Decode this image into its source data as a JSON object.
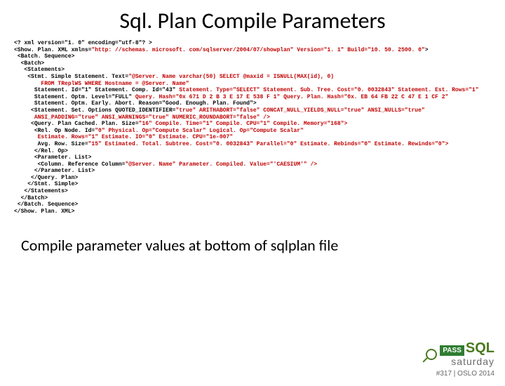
{
  "title": "Sql. Plan Compile Parameters",
  "xml": {
    "decl": "<? xml version=\"1. 0\" encoding=\"utf-8\"? >",
    "showplan_open": "<Show. Plan. XML xmlns=",
    "showplan_ns": "\"http: //schemas. microsoft. com/sqlserver/2004/07/showplan\"",
    "showplan_ver": " Version=\"1. 1\" Build=\"10. 50. 2500. 0\"",
    "showplan_close": ">",
    "batchseq_open": " <Batch. Sequence>",
    "batch_open": "  <Batch>",
    "statements_open": "   <Statements>",
    "stmtsimple_open": "    <Stmt. Simple Statement. Text=",
    "stmt_text": "\"@Server. Name varchar(50) SELECT @maxid = ISNULL(MAX(id), 0)",
    "stmt_text2": "        FROM TReplWS WHERE Hostname = @Server. Name\"",
    "stmt_line_a": "      Statement. Id=\"1\" Statement. Comp. Id=\"43\"",
    "stmt_type": " Statement. Type=\"SELECT\" Statement. Sub. Tree. Cost=\"0. 0032843\" Statement. Est. Rows=\"1\"",
    "stmt_line_b": "      Statement. Optm. Level=\"FULL\"",
    "stmt_hash": " Query. Hash=\"0x 671 D 2 B 3 E 17 E 538 F 1\" Query. Plan. Hash=\"0x. EB 64 FB 22 C 47 E 1 CF 2\"",
    "stmt_line_c": "      Statement. Optm. Early. Abort. Reason=\"Good. Enough. Plan. Found\">",
    "setopt_open": "     <Statement. Set. Options QUOTED_IDENTIFIER=",
    "setopt_attrs1": "\"true\" ARITHABORT=\"false\" CONCAT_NULL_YIELDS_NULL=\"true\" ANSI_NULLS=\"true\"",
    "setopt_attrs2": "      ANSI_PADDING=\"true\" ANSI_WARNINGS=\"true\" NUMERIC_ROUNDABORT=\"false\" />",
    "qp_open": "     <Query. Plan Cached. Plan. Size=",
    "qp_attrs": "\"16\" Compile. Time=\"1\" Compile. CPU=\"1\" Compile. Memory=\"168\">",
    "relop_open": "      <Rel. Op Node. Id=",
    "relop_attrs": "\"0\" Physical. Op=\"Compute Scalar\" Logical. Op=\"Compute Scalar\"",
    "est_line": "       Estimate. Rows=\"1\" Estimate. IO=\"0\" Estimate. CPU=\"1e-007\"",
    "avg_open": "       Avg. Row. Size=",
    "avg_attrs": "\"15\" Estimated. Total. Subtree. Cost=\"0. 0032843\" Parallel=\"0\" Estimate. Rebinds=\"0\" Estimate. Rewinds=\"0\">",
    "relop_close": "      </Rel. Op>",
    "paramlist_open": "      <Parameter. List>",
    "colref_open": "       <Column. Reference Column=",
    "colref_attrs": "\"@Server. Name\" Parameter. Compiled. Value=\"'CAESIUM'\" />",
    "paramlist_close": "      </Parameter. List>",
    "qp_close": "     </Query. Plan>",
    "stmtsimple_close": "    </Stmt. Simple>",
    "statements_close": "   </Statements>",
    "batch_close": "  </Batch>",
    "batchseq_close": " </Batch. Sequence>",
    "showplan_closetag": "</Show. Plan. XML>"
  },
  "note": "Compile parameter values at bottom of sqlplan file",
  "logo": {
    "pass": "PASS",
    "sql": "SQL",
    "saturday": "saturday",
    "event": "#317 | OSLO 2014"
  }
}
